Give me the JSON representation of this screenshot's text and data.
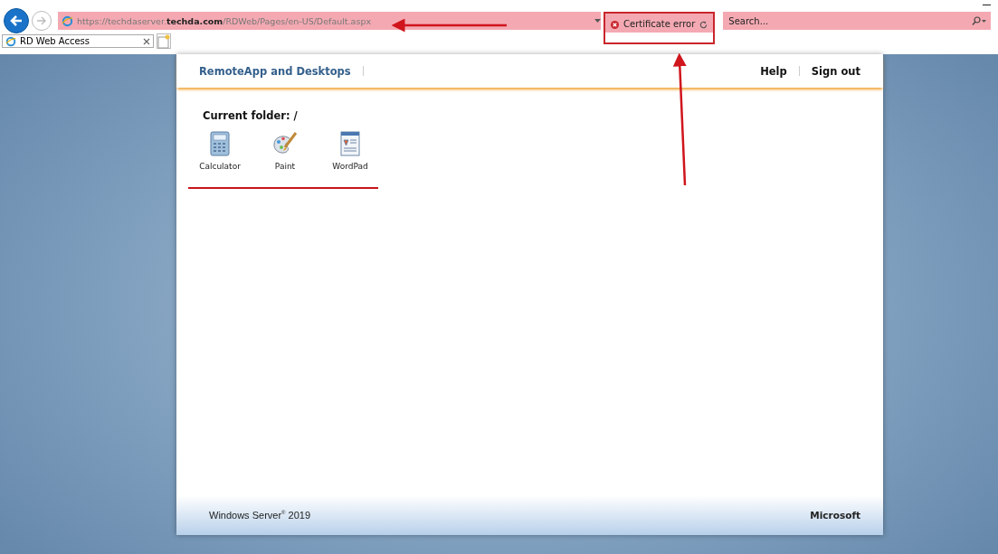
{
  "browser": {
    "url": "https://techdaserver.**techda.com**/RDWeb/Pages/en-US/Default.aspx",
    "security": "Certificate error",
    "search": {
      "placeholder": "Search..."
    },
    "tabs": [
      {
        "label": "RD Web Access",
        "selected": true
      }
    ]
  },
  "page": {
    "brand": "RemoteApp and Desktops",
    "nav": [
      "Help",
      "Sign out"
    ],
    "folder": "Current folder: /",
    "apps": [
      {
        "name": "Calculator",
        "kind": "calculator"
      },
      {
        "name": "Paint",
        "kind": "paint"
      },
      {
        "name": "WordPad",
        "kind": "wordpad"
      }
    ],
    "footer_product": "Windows Server$^{®}$ 2019",
    "footer_brand": "Microsoft"
  }
}
